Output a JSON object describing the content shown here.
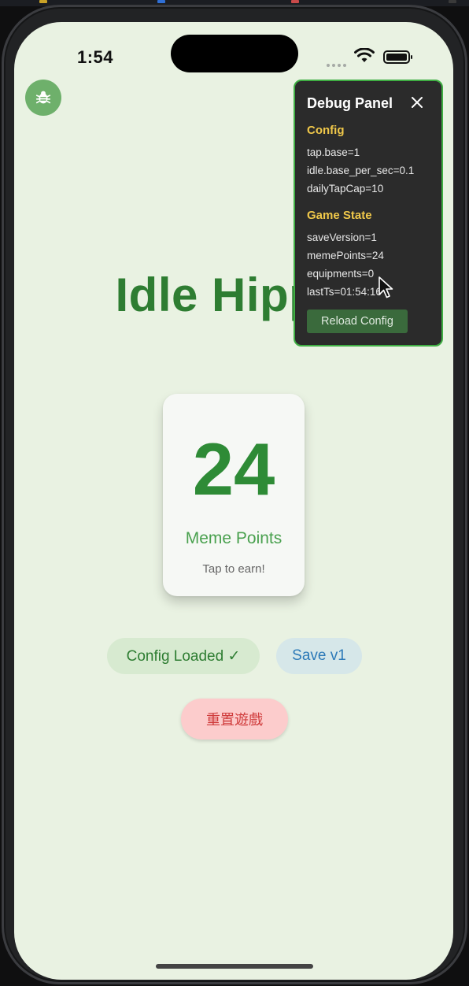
{
  "status_bar": {
    "time": "1:54"
  },
  "app": {
    "title": "Idle Hippo",
    "points_value": "24",
    "points_label": "Meme Points",
    "tap_hint": "Tap to earn!",
    "config_chip": "Config Loaded ✓",
    "save_chip": "Save v1",
    "reset_button": "重置遊戲"
  },
  "debug_panel": {
    "title": "Debug Panel",
    "config_section": "Config",
    "config_lines": [
      "tap.base=1",
      "idle.base_per_sec=0.1",
      "dailyTapCap=10"
    ],
    "state_section": "Game State",
    "state_lines": [
      "saveVersion=1",
      "memePoints=24",
      "equipments=0",
      "lastTs=01:54:16"
    ],
    "reload_button": "Reload Config"
  },
  "icons": {
    "debug_fab": "bug-icon",
    "close": "close-icon",
    "wifi": "wifi-icon",
    "battery": "battery-icon",
    "cursor": "mouse-pointer-icon"
  },
  "colors": {
    "background": "#e9f2e2",
    "title_green": "#2e7d32",
    "panel_bg": "#2b2b2b",
    "panel_border": "#3fae43",
    "section_yellow": "#f0c84a",
    "reset_bg": "#fccccc",
    "reset_text": "#cf3a3a"
  }
}
